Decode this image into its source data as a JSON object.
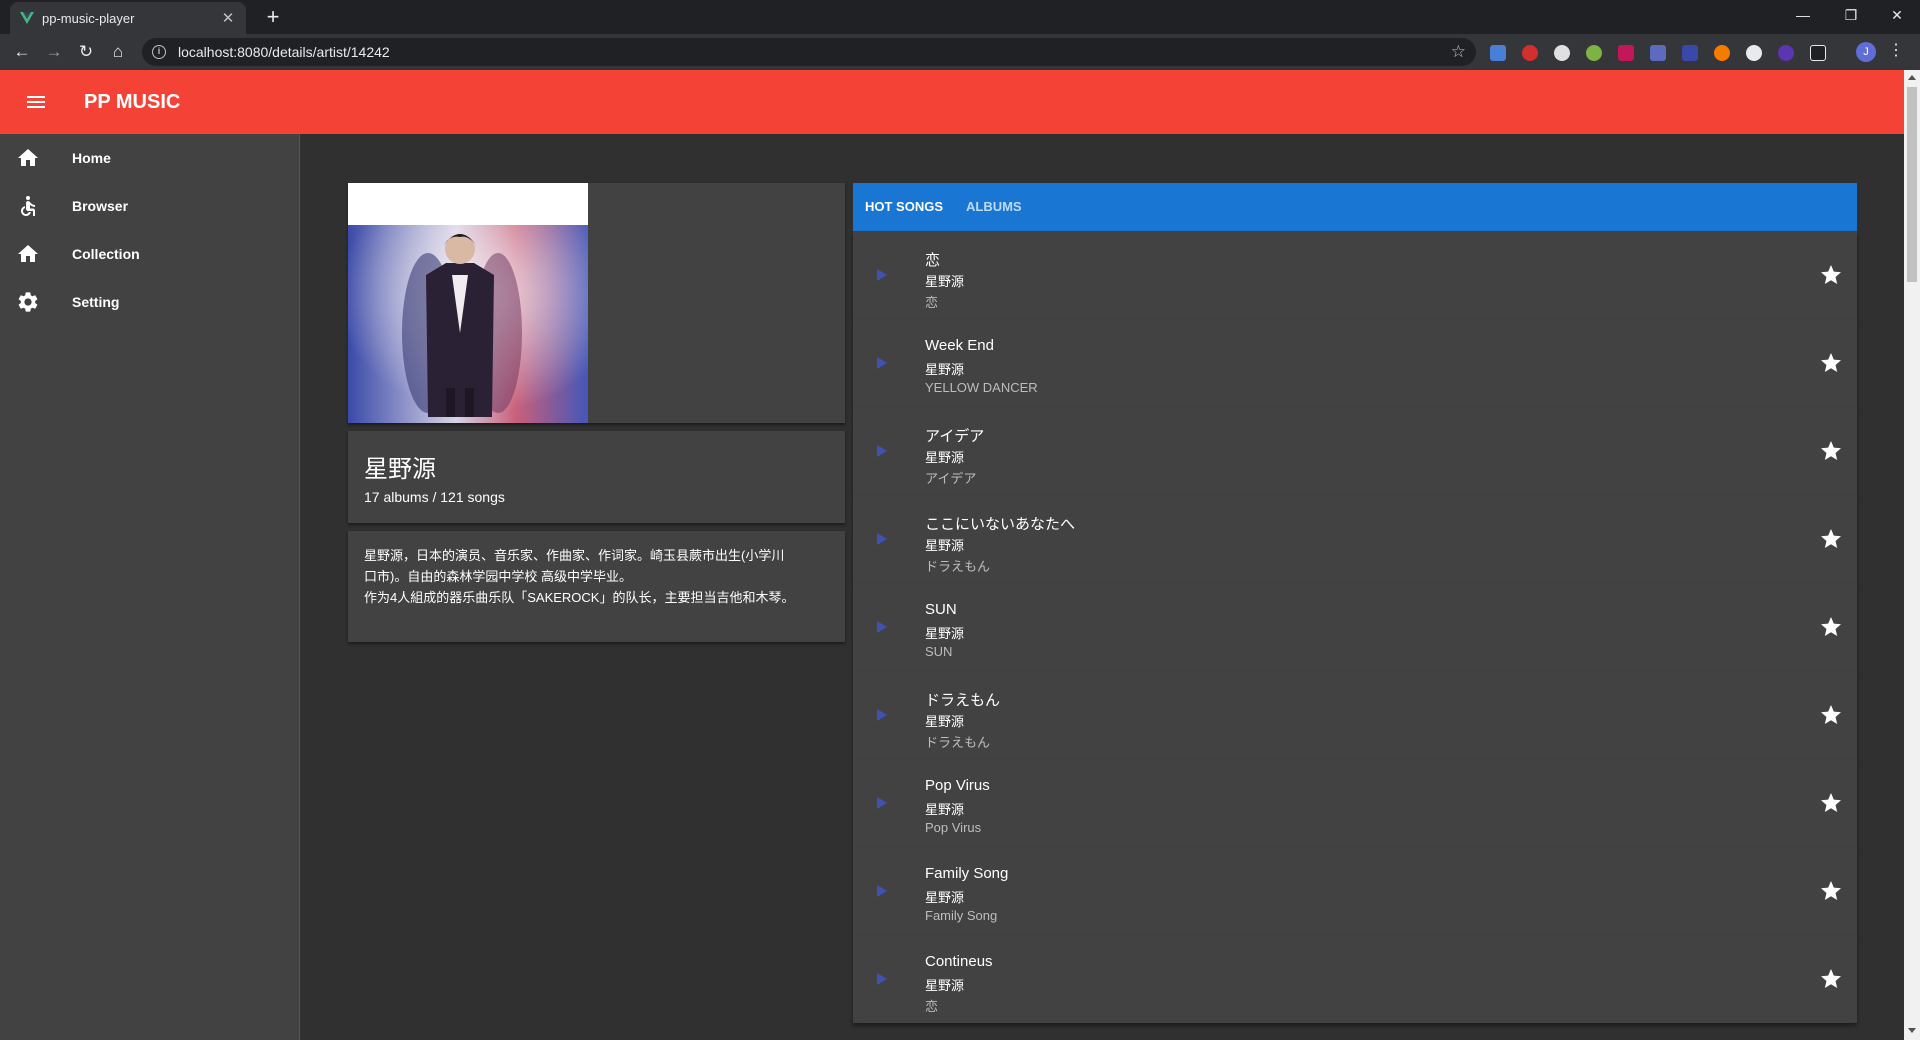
{
  "browser": {
    "tab_title": "pp-music-player",
    "url": "localhost:8080/details/artist/14242",
    "profile_initial": "J"
  },
  "app": {
    "title": "PP MUSIC"
  },
  "drawer": {
    "items": [
      {
        "label": "Home",
        "icon": "home-icon"
      },
      {
        "label": "Browser",
        "icon": "accessibility-icon"
      },
      {
        "label": "Collection",
        "icon": "home-icon"
      },
      {
        "label": "Setting",
        "icon": "gear-icon"
      }
    ]
  },
  "artist": {
    "name": "星野源",
    "stats": "17 albums / 121 songs",
    "bio_lines": [
      "星野源，日本的演员、音乐家、作曲家、作词家。崎玉县蕨市出生(小学川",
      "口市)。自由的森林学园中学校 高级中学毕业。",
      "作为4人組成的器乐曲乐队「SAKEROCK」的队长，主要担当吉他和木琴。"
    ]
  },
  "tabs": {
    "hot_songs": "HOT SONGS",
    "albums": "ALBUMS"
  },
  "songs": [
    {
      "title": "恋",
      "artist": "星野源",
      "album": "恋"
    },
    {
      "title": "Week End",
      "artist": "星野源",
      "album": "YELLOW DANCER"
    },
    {
      "title": "アイデア",
      "artist": "星野源",
      "album": "アイデア"
    },
    {
      "title": "ここにいないあなたへ",
      "artist": "星野源",
      "album": "ドラえもん"
    },
    {
      "title": "SUN",
      "artist": "星野源",
      "album": "SUN"
    },
    {
      "title": "ドラえもん",
      "artist": "星野源",
      "album": "ドラえもん"
    },
    {
      "title": "Pop Virus",
      "artist": "星野源",
      "album": "Pop Virus"
    },
    {
      "title": "Family Song",
      "artist": "星野源",
      "album": "Family Song"
    },
    {
      "title": "Contineus",
      "artist": "星野源",
      "album": "恋"
    }
  ],
  "colors": {
    "appbar": "#f44336",
    "tabs_bar": "#1976d2",
    "play_icon": "#3f51b5",
    "surface": "#424242",
    "background": "#303030"
  }
}
